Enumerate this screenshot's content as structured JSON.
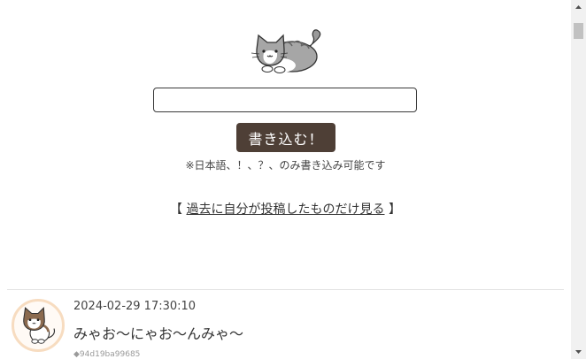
{
  "composer": {
    "input_value": "",
    "submit_label": "書き込む！",
    "note": "※日本語、！、？、のみ書き込み可能です"
  },
  "history_link": {
    "open_bracket": "【",
    "label": "過去に自分が投稿したものだけ見る",
    "close_bracket": "】"
  },
  "posts": [
    {
      "timestamp": "2024-02-29 17:30:10",
      "message": "みゃお〜にゃお〜んみゃ〜",
      "id": "◆94d19ba99685"
    }
  ],
  "colors": {
    "button_bg": "#4e3f36",
    "avatar_ring": "#f7dcc0"
  },
  "icons": {
    "hero": "cat-illustration",
    "avatar": "cat-avatar",
    "scroll_up": "arrow-up",
    "scroll_down": "arrow-down"
  }
}
